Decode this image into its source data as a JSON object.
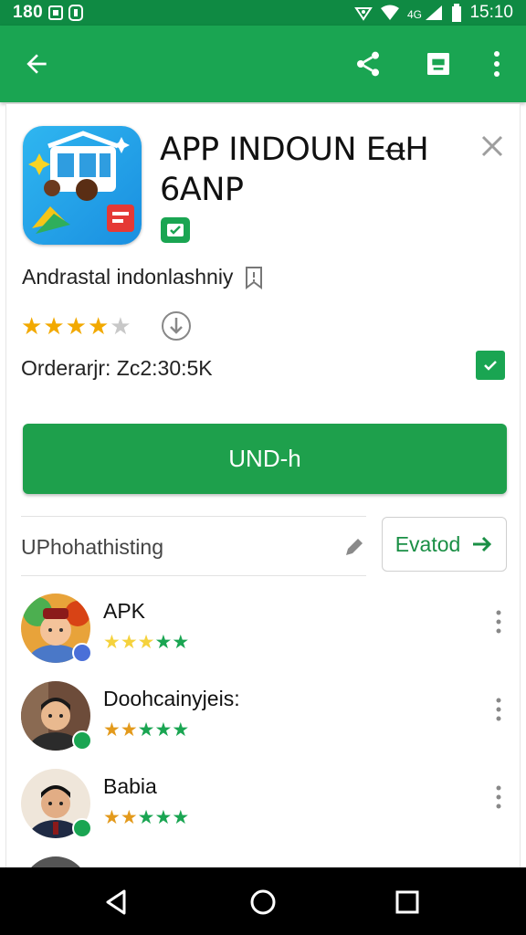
{
  "status_bar": {
    "left_text": "180",
    "time": "15:10"
  },
  "toolbar": {
    "back_icon": "arrow-back-icon",
    "share_icon": "share-icon",
    "bookmark_icon": "bookmark-icon",
    "more_icon": "more-vert-icon"
  },
  "app": {
    "title": "APP INDOUN EꬰH 6ANP",
    "developer": "Andrastal indonlashniy",
    "rating_stars": 4,
    "rating_max": 5,
    "order_text": "Orderarjr: Zc2:30:5K",
    "install_label": "UND-h"
  },
  "reviews_header": {
    "sort_label": "UPhohathisting",
    "expand_label": "Evatod"
  },
  "reviews": [
    {
      "name": "APK",
      "stars": [
        "#f5d23d",
        "#f5d23d",
        "#f5d23d",
        "#1aa552",
        "#1aa552"
      ],
      "badge_color": "#4a6fd8"
    },
    {
      "name": "Doohcainyjeis:",
      "stars": [
        "#e39a1c",
        "#e39a1c",
        "#1aa552",
        "#1aa552",
        "#1aa552"
      ],
      "badge_color": "#1aa552"
    },
    {
      "name": "Babia",
      "stars": [
        "#e39a1c",
        "#e39a1c",
        "#1aa552",
        "#1aa552",
        "#1aa552"
      ],
      "badge_color": "#1aa552"
    }
  ],
  "colors": {
    "primary": "#1aa552",
    "primary_dark": "#0f8a43",
    "star": "#f2a900"
  }
}
